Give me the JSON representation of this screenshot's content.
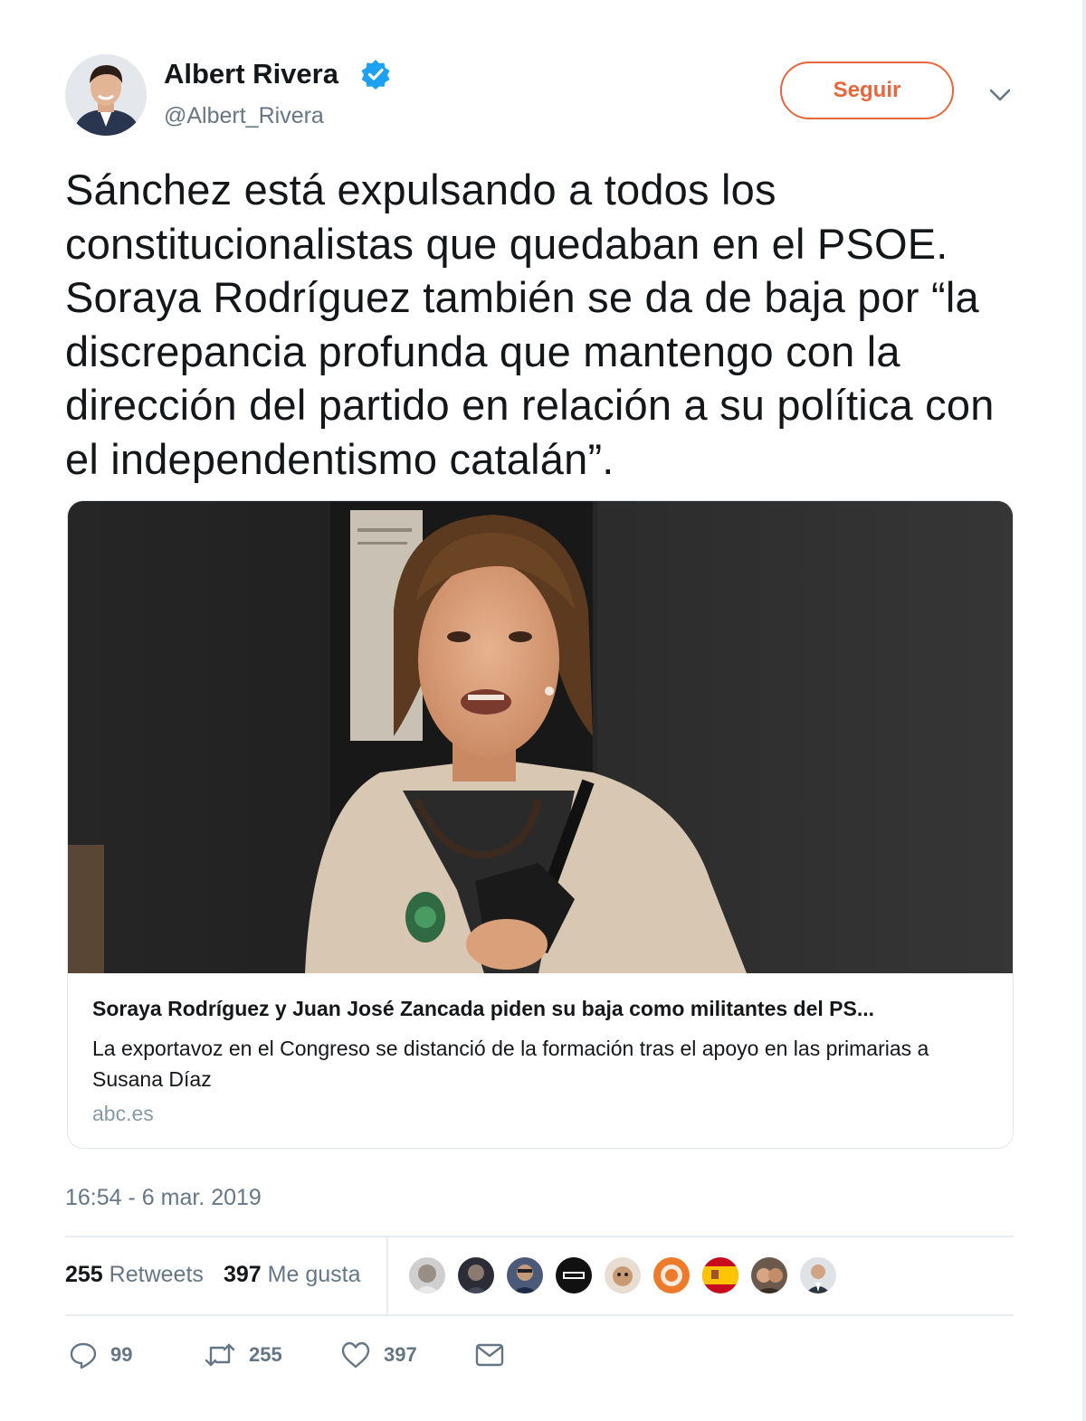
{
  "author": {
    "name": "Albert Rivera",
    "handle": "@Albert_Rivera",
    "verified": true,
    "avatar_icon": "avatar-photo"
  },
  "header": {
    "follow_label": "Seguir",
    "more_icon": "chevron-down-icon"
  },
  "tweet": {
    "text": "Sánchez está expulsando a todos los constitucionalistas que quedaban en el PSOE. Soraya Rodríguez también se da de baja por “la discrepancia profunda que mantengo con la dirección del partido en relación a su política con el independentismo catalán”."
  },
  "card": {
    "title": "Soraya Rodríguez y Juan José Zancada piden su baja como militantes del PS...",
    "description": "La exportavoz en el Congreso se distanció de la formación tras el apoyo en las primarias a Susana Díaz",
    "domain": "abc.es"
  },
  "timestamp": "16:54 - 6 mar. 2019",
  "stats": {
    "retweets_count": "255",
    "retweets_label": "Retweets",
    "likes_count": "397",
    "likes_label": "Me gusta"
  },
  "actions": {
    "reply_count": "99",
    "retweet_count": "255",
    "like_count": "397"
  },
  "colors": {
    "accent": "#e8663b",
    "verified": "#1da1f2",
    "muted": "#657786",
    "border": "#e1e8ed"
  }
}
